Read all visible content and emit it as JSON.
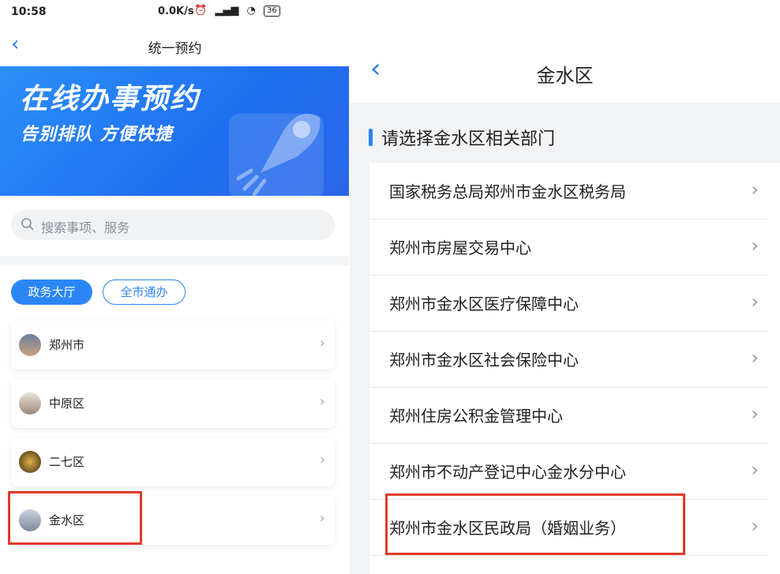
{
  "status_bar": {
    "time": "10:58",
    "speed": "0.0K/s",
    "battery": "36"
  },
  "left_screen": {
    "title": "统一预约",
    "banner": {
      "title": "在线办事预约",
      "subtitle": "告别排队  方便快捷"
    },
    "search": {
      "placeholder": "搜索事项、服务"
    },
    "tabs": [
      {
        "label": "政务大厅",
        "active": true
      },
      {
        "label": "全市通办",
        "active": false
      }
    ],
    "districts": [
      {
        "label": "郑州市"
      },
      {
        "label": "中原区"
      },
      {
        "label": "二七区"
      },
      {
        "label": "金水区"
      }
    ]
  },
  "right_screen": {
    "title": "金水区",
    "section_title": "请选择金水区相关部门",
    "departments": [
      {
        "label": "国家税务总局郑州市金水区税务局"
      },
      {
        "label": "郑州市房屋交易中心"
      },
      {
        "label": "郑州市金水区医疗保障中心"
      },
      {
        "label": "郑州市金水区社会保险中心"
      },
      {
        "label": "郑州住房公积金管理中心"
      },
      {
        "label": "郑州市不动产登记中心金水分中心"
      },
      {
        "label": "郑州市金水区民政局（婚姻业务）"
      }
    ]
  },
  "colors": {
    "accent": "#2b86f5",
    "highlight": "#e0392b"
  }
}
